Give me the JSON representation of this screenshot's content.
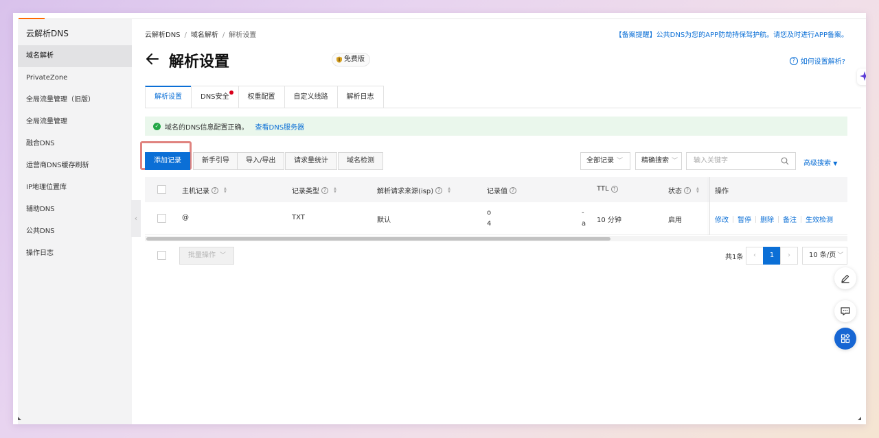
{
  "sidebar": {
    "product": "云解析DNS",
    "items": [
      {
        "label": "域名解析"
      },
      {
        "label": "PrivateZone"
      },
      {
        "label": "全局流量管理（旧版）"
      },
      {
        "label": "全局流量管理"
      },
      {
        "label": "融合DNS"
      },
      {
        "label": "运营商DNS缓存刷新"
      },
      {
        "label": "IP地理位置库"
      },
      {
        "label": "辅助DNS"
      },
      {
        "label": "公共DNS"
      },
      {
        "label": "操作日志"
      }
    ],
    "active_item": "域名解析"
  },
  "breadcrumb": [
    "云解析DNS",
    "域名解析",
    "解析设置"
  ],
  "notice": "【备案提醒】公共DNS为您的APP防劫持保驾护航。请您及时进行APP备案。",
  "page": {
    "title": "解析设置",
    "edition_badge": "免费版",
    "help_link": "如何设置解析?"
  },
  "tabs": [
    {
      "label": "解析设置"
    },
    {
      "label": "DNS安全"
    },
    {
      "label": "权重配置"
    },
    {
      "label": "自定义线路"
    },
    {
      "label": "解析日志"
    }
  ],
  "alert": {
    "text": "域名的DNS信息配置正确。",
    "link": "查看DNS服务器"
  },
  "toolbar": {
    "add_record": "添加记录",
    "guide": "新手引导",
    "import_export": "导入/导出",
    "request_stats": "请求量统计",
    "domain_check": "域名检测",
    "record_filter": "全部记录",
    "search_mode": "精确搜索",
    "search_placeholder": "输入关键字",
    "advanced_search": "高级搜索"
  },
  "table": {
    "columns": [
      "主机记录",
      "记录类型",
      "解析请求来源(isp)",
      "记录值",
      "TTL",
      "状态",
      "操作"
    ],
    "rows": [
      {
        "host": "@",
        "type": "TXT",
        "isp": "默认",
        "value_fragments": [
          "o",
          "4",
          "-",
          "a"
        ],
        "ttl": "10 分钟",
        "status": "启用",
        "actions": [
          "修改",
          "暂停",
          "删除",
          "备注",
          "生效检测"
        ]
      }
    ]
  },
  "footer": {
    "batch_action": "批量操作",
    "total": "共1条",
    "current_page": "1",
    "page_size": "10 条/页"
  },
  "colors": {
    "primary": "#0b6fd6",
    "success": "#23a746",
    "highlight": "#e0837f",
    "accent": "#ff6a00"
  },
  "icons": [
    "back-arrow-icon",
    "shield-icon",
    "question-circle-icon",
    "sparkle-icon",
    "check-circle-icon",
    "search-icon",
    "chevron-down-icon",
    "pencil-icon",
    "chat-icon",
    "apps-icon"
  ]
}
